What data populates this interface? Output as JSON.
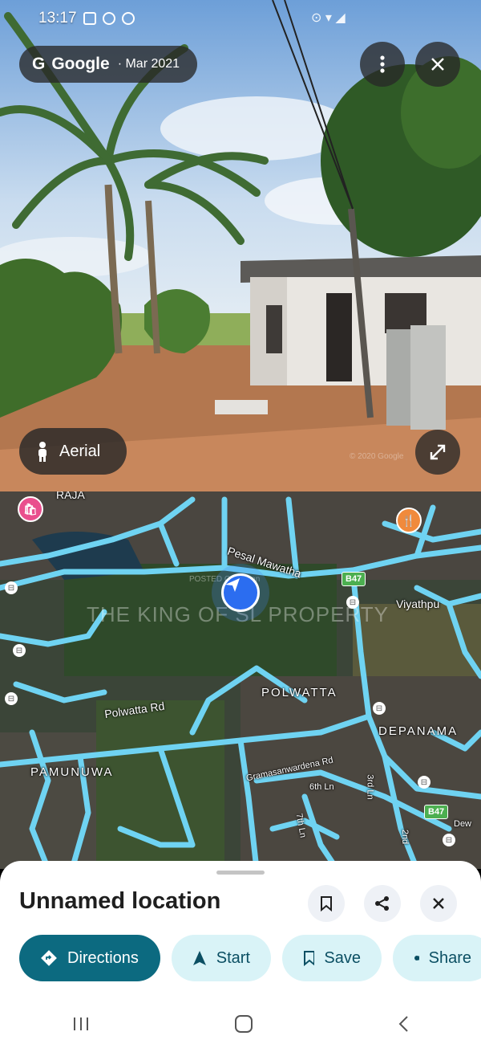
{
  "status_bar": {
    "time": "13:17",
    "right_icons": "⊙ ▾ ◢"
  },
  "street_view": {
    "provider": "Google",
    "date": "· Mar 2021",
    "aerial_label": "Aerial",
    "watermark": "© 2020 Google"
  },
  "map": {
    "labels": {
      "road1": "Pesal Mawatha",
      "road2": "Polwatta Rd",
      "road3": "Gramasanwardena Rd",
      "road4": "6th Ln",
      "road5": "3rd Ln",
      "road6": "7th Ln",
      "road7": "2nd",
      "road8": "Dew",
      "road9": "Viyathpu",
      "area1": "POLWATTA",
      "area2": "DEPANAMA",
      "area3": "PAMUNUWA",
      "top_cut": "RAJA"
    },
    "shields": [
      "B47",
      "B47"
    ],
    "watermark": "THE KING OF SL PROPERTY",
    "watermark_small": "POSTED ON ikman"
  },
  "sheet": {
    "title": "Unnamed location",
    "actions": [
      {
        "label": "Directions",
        "icon": "directions-icon"
      },
      {
        "label": "Start",
        "icon": "navigation-icon"
      },
      {
        "label": "Save",
        "icon": "bookmark-icon"
      },
      {
        "label": "Share",
        "icon": "share-icon"
      }
    ]
  },
  "colors": {
    "primary": "#0c6a80",
    "road": "#6fd3f2",
    "pill_bg": "#d9f3f7"
  }
}
